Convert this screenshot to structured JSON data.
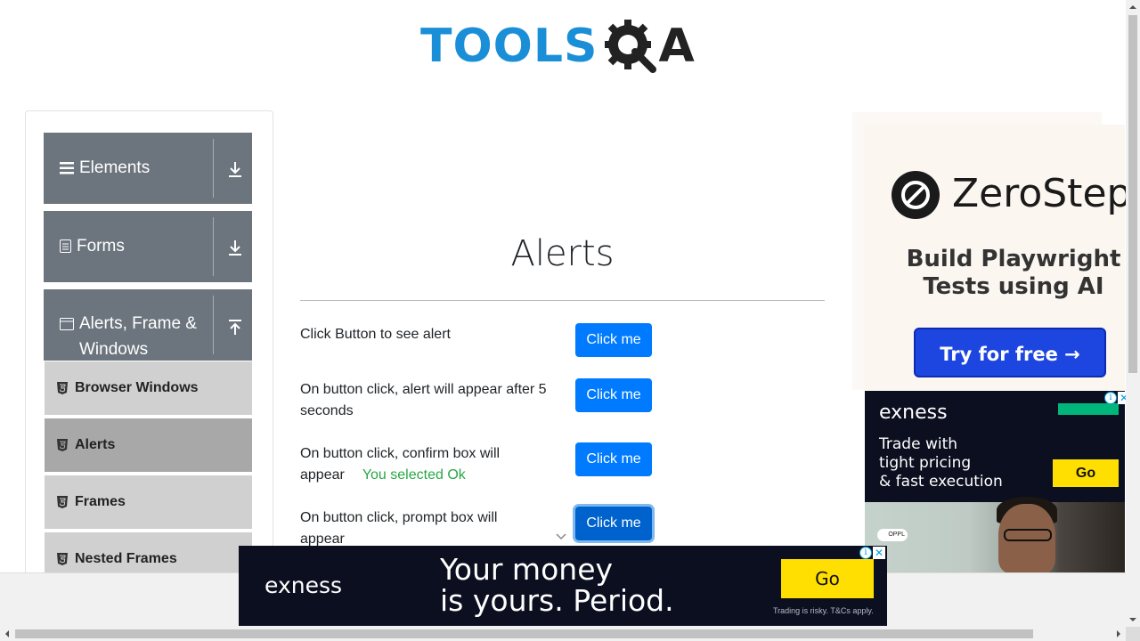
{
  "header": {
    "logo_text": "TOOLS",
    "logo_text_suffix": "A"
  },
  "sidebar": {
    "groups": [
      {
        "label": "Elements",
        "icon": "hamburger-icon",
        "arrow": "download-arrow-icon"
      },
      {
        "label": "Forms",
        "icon": "document-icon",
        "arrow": "download-arrow-icon"
      },
      {
        "label_line1": "Alerts, Frame &",
        "label_line2": "Windows",
        "icon": "window-icon",
        "arrow": "upload-arrow-icon"
      }
    ],
    "items": [
      {
        "label": "Browser Windows",
        "active": false
      },
      {
        "label": "Alerts",
        "active": true
      },
      {
        "label": "Frames",
        "active": false
      },
      {
        "label": "Nested Frames",
        "active": false
      }
    ]
  },
  "main": {
    "title": "Alerts",
    "rows": [
      {
        "text": "Click Button to see alert",
        "button": "Click me"
      },
      {
        "text_line1": "On button click, alert will appear after 5",
        "text_line2": "seconds",
        "button": "Click me"
      },
      {
        "text_line1": "On button click, confirm box will",
        "text_line2": "appear",
        "result": "You selected Ok",
        "button": "Click me"
      },
      {
        "text_line1": "On button click, prompt box will",
        "text_line2": "appear",
        "button": "Click me"
      }
    ]
  },
  "ads": {
    "zerostep": {
      "brand": "ZeroStep",
      "headline_line1": "Build Playwright",
      "headline_line2": "Tests using AI",
      "cta": "Try for free →"
    },
    "exness_side": {
      "brand": "exness",
      "line1": "Trade with",
      "line2": "tight pricing",
      "line3": "& fast execution",
      "cta": "Go",
      "phone_label": "OPPL"
    },
    "exness_bottom": {
      "brand": "exness",
      "line1": "Your money",
      "line2": "is yours. Period.",
      "cta": "Go",
      "disclaimer": "Trading is risky. T&Cs apply."
    }
  },
  "colors": {
    "brand_blue": "#1a8fd8",
    "button_blue": "#007bff",
    "sidebar_group": "#6c757d",
    "success_green": "#28a745",
    "exness_yellow": "#ffde02"
  }
}
